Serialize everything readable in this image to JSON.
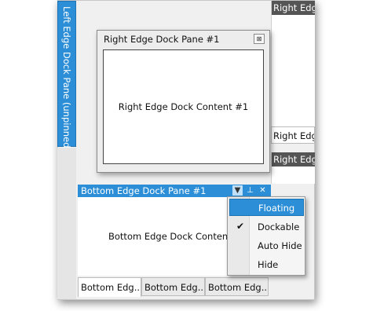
{
  "left_dock": {
    "tab_label": "Left Edge Dock Pane (unpinned)"
  },
  "right_dock": {
    "top_pane_title": "Right Edge",
    "tab_label": "Right Edge",
    "lower_pane_title": "Right Edge"
  },
  "floating_window": {
    "title": "Right Edge Dock Pane #1",
    "close_glyph": "⊠",
    "content": "Right Edge Dock Content #1"
  },
  "bottom_pane": {
    "title": "Bottom Edge Dock Pane #1",
    "content": "Bottom Edge Dock Content #",
    "buttons": {
      "menu": "▼",
      "pin": "⊥",
      "close": "✕"
    },
    "tabs": [
      "Bottom Edg...",
      "Bottom Edg...",
      "Bottom Edg..."
    ]
  },
  "context_menu": {
    "items": [
      {
        "label": "Floating",
        "highlighted": true
      },
      {
        "label": "Dockable",
        "checked": true
      },
      {
        "label": "Auto Hide"
      },
      {
        "label": "Hide"
      }
    ],
    "check_glyph": "✔"
  },
  "colors": {
    "accent": "#2b8ed6",
    "dark_title": "#555555"
  }
}
